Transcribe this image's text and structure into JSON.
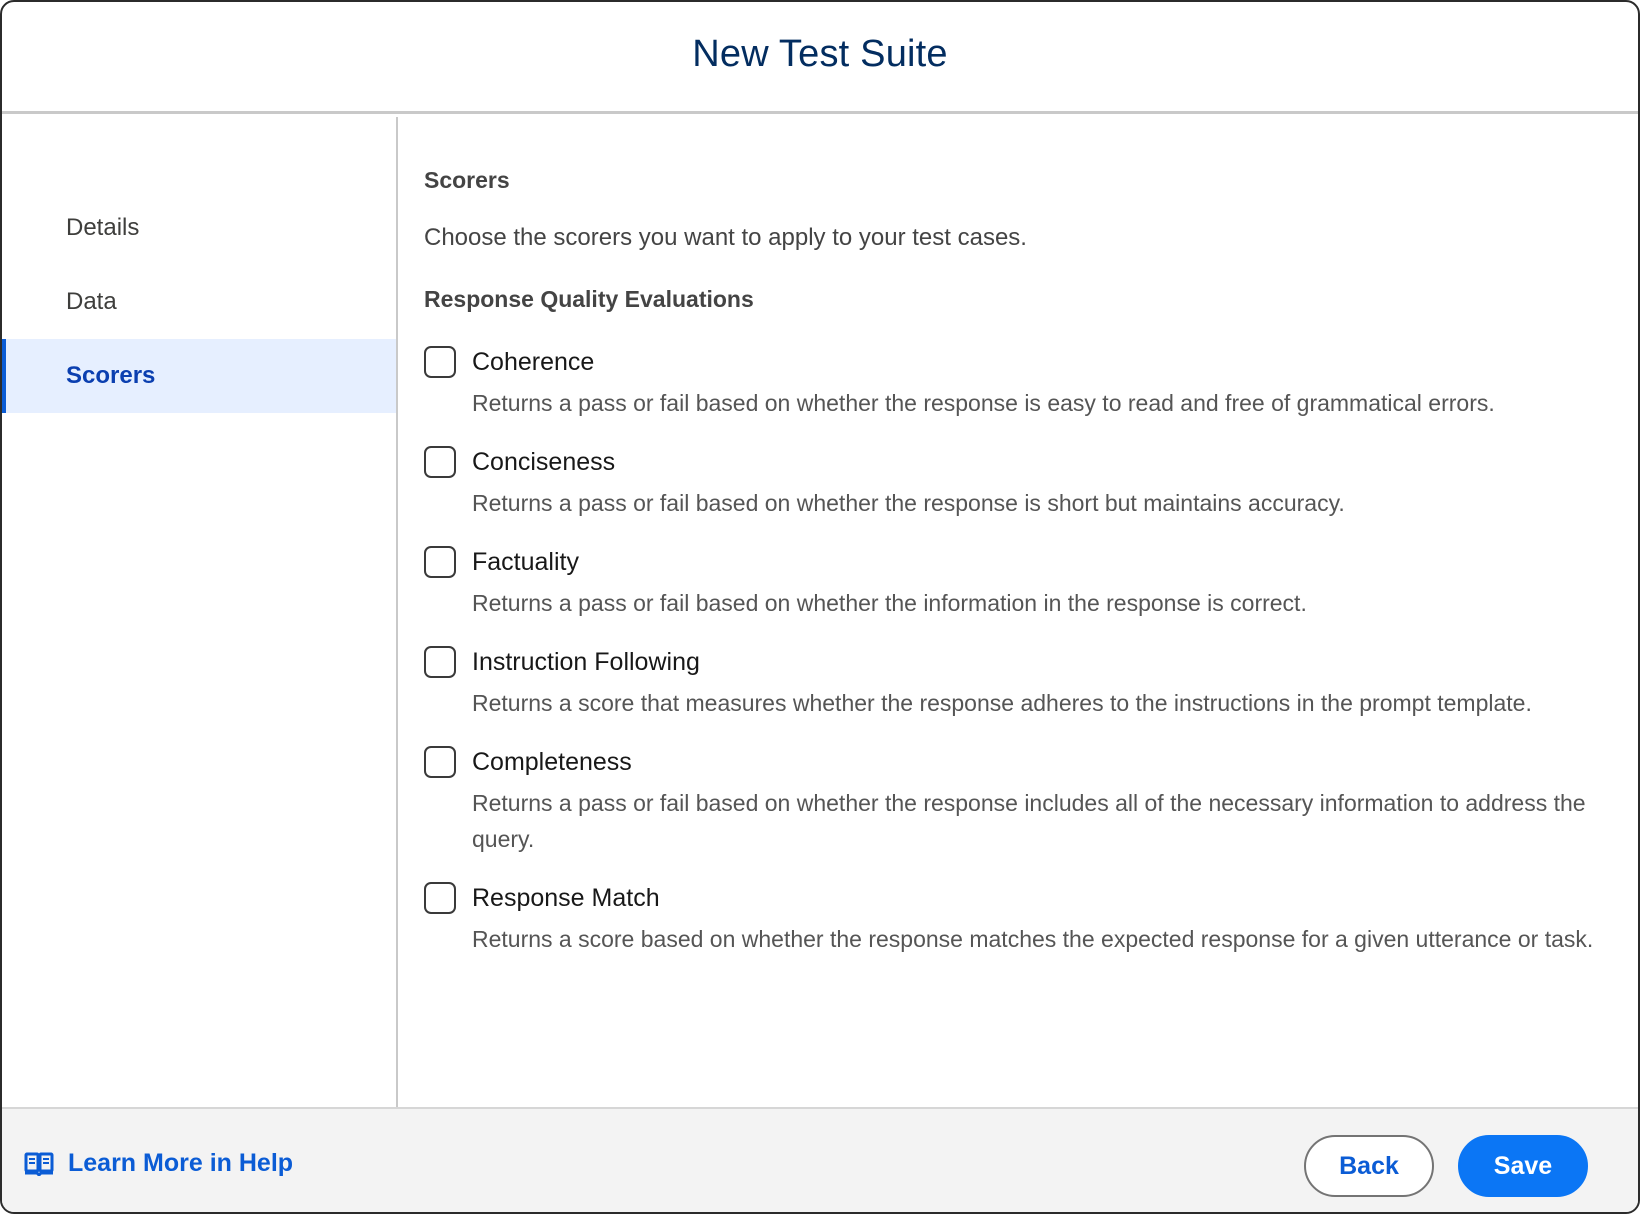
{
  "dialog": {
    "title": "New Test Suite"
  },
  "sidebar": {
    "items": [
      {
        "label": "Details",
        "active": false
      },
      {
        "label": "Data",
        "active": false
      },
      {
        "label": "Scorers",
        "active": true
      }
    ]
  },
  "main": {
    "section_title": "Scorers",
    "intro": "Choose the scorers you want to apply to your test cases.",
    "group_title": "Response Quality Evaluations",
    "scorers": [
      {
        "name": "Coherence",
        "description": "Returns a pass or fail based on whether the response is easy to read and free of grammatical errors.",
        "checked": false
      },
      {
        "name": "Conciseness",
        "description": "Returns a pass or fail based on whether the response is short but maintains accuracy.",
        "checked": false
      },
      {
        "name": "Factuality",
        "description": "Returns a pass or fail based on whether the information in the response is correct.",
        "checked": false
      },
      {
        "name": "Instruction Following",
        "description": "Returns a score that measures whether the response adheres to the instructions in the prompt template.",
        "checked": false
      },
      {
        "name": "Completeness",
        "description": "Returns a pass or fail based on whether the response includes all of the necessary information to address the query.",
        "checked": false
      },
      {
        "name": "Response Match",
        "description": "Returns a score based on whether the response matches the expected response for a given utterance or task.",
        "checked": false
      }
    ]
  },
  "footer": {
    "help_label": "Learn More in Help",
    "help_icon": "book-icon",
    "back_label": "Back",
    "save_label": "Save"
  },
  "colors": {
    "title": "#032d60",
    "accent": "#0b5cd5",
    "primary_button": "#0b76f5",
    "active_nav_bg": "#e6efff"
  }
}
